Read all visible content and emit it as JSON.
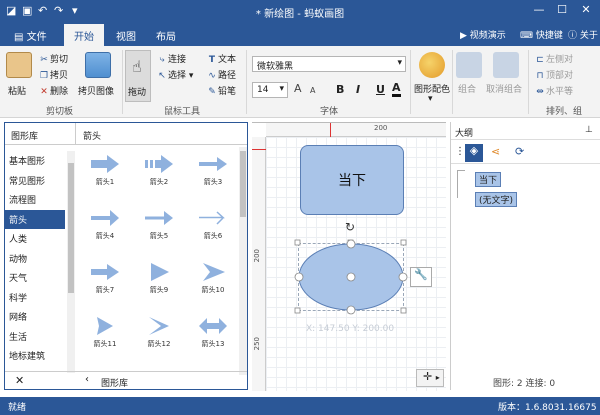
{
  "window": {
    "title": "* 新绘图 - 蚂蚁画图",
    "min": "—",
    "max": "☐",
    "close": "✕"
  },
  "menu": {
    "file": "文件",
    "tabs": [
      "开始",
      "视图",
      "布局"
    ],
    "right": {
      "video": "视频演示",
      "shortcut": "快捷键",
      "about": "关于"
    }
  },
  "ribbon": {
    "clipboard": {
      "paste": "粘贴",
      "cut": "剪切",
      "copy": "拷贝",
      "delete": "删除",
      "copy_image": "拷贝图像",
      "label": "剪切板"
    },
    "mouse": {
      "drag": "拖动",
      "connect": "连接",
      "select": "选择",
      "text": "文本",
      "path": "路径",
      "pencil": "铅笔",
      "label": "鼠标工具"
    },
    "font": {
      "family": "微软雅黑",
      "size": "14",
      "bold": "B",
      "italic": "I",
      "underline": "U",
      "color": "A",
      "label": "字体"
    },
    "shape_style": {
      "label": "图形配色"
    },
    "arrange": {
      "group": "组合",
      "ungroup": "取消组合",
      "align_left": "左侧对",
      "align_top": "顶部对",
      "align_h": "水平等",
      "label": "排列、组"
    }
  },
  "library": {
    "header_left": "图形库",
    "header_right": "箭头",
    "categories": [
      "基本图形",
      "常见图形",
      "流程图",
      "箭头",
      "人类",
      "动物",
      "天气",
      "科学",
      "网络",
      "生活",
      "地标建筑"
    ],
    "selected_index": 3,
    "shapes": [
      "箭头1",
      "箭头2",
      "箭头3",
      "箭头4",
      "箭头5",
      "箭头6",
      "箭头7",
      "箭头9",
      "箭头10",
      "箭头11",
      "箭头12",
      "箭头13"
    ],
    "close": "✕",
    "footer_back": "‹",
    "footer_label": "图形库"
  },
  "canvas": {
    "ruler_h_label": "200",
    "ruler_v_label_1": "200",
    "ruler_v_label_2": "250",
    "rect_text": "当下",
    "coords": "X: 147.50  Y: 200.00",
    "move_icon": "✛"
  },
  "outline": {
    "title": "大纲",
    "pin": "⊥",
    "tree_item_1": "当下",
    "tree_item_2": "(无文字)",
    "footer": "图形: 2    连接: 0"
  },
  "status": {
    "left": "就绪",
    "version": "版本：1.6.8031.16675"
  },
  "colors": {
    "brand": "#2b5797",
    "shape_fill": "#a9c4e8",
    "shape_stroke": "#5b7fb5",
    "arrow_fill": "#8fb1de"
  }
}
